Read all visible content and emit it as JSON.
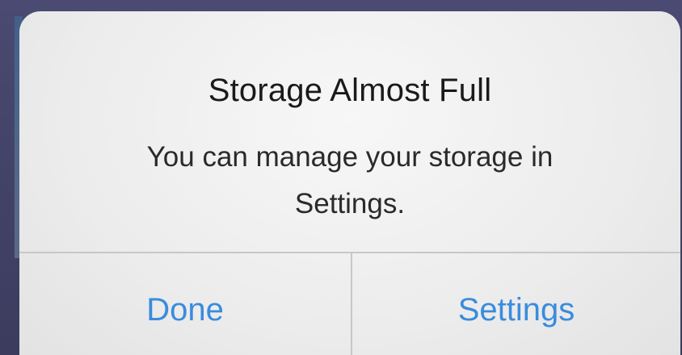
{
  "alert": {
    "title": "Storage Almost Full",
    "message": "You can manage your storage in Settings.",
    "buttons": [
      {
        "label": "Done"
      },
      {
        "label": "Settings"
      }
    ]
  },
  "colors": {
    "button_text": "#3a8cdc",
    "background": "#3e3e62",
    "alert_background": "#f2f2f2"
  }
}
